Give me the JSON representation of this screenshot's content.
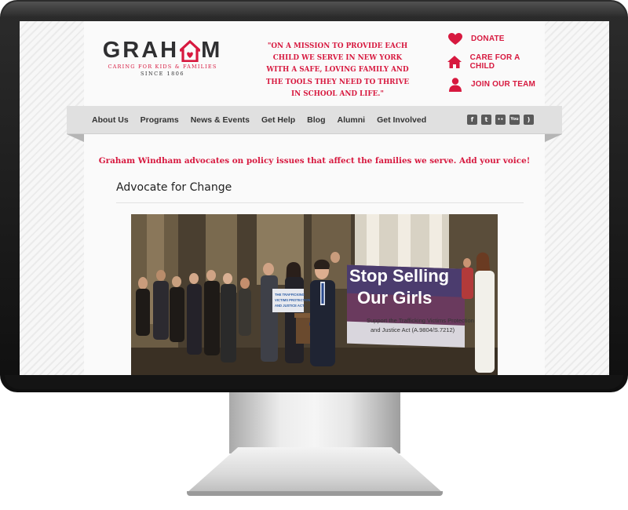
{
  "brand": {
    "logo_word": "GRAHAM",
    "tagline": "CARING FOR KIDS & FAMILIES",
    "since": "SINCE 1806",
    "accent": "#d7193f",
    "dark": "#2f2f31"
  },
  "mission": "\"ON A MISSION TO PROVIDE EACH CHILD WE SERVE IN NEW YORK WITH A SAFE, LOVING FAMILY AND THE TOOLS THEY NEED TO THRIVE IN SCHOOL AND LIFE.\"",
  "quick_links": [
    {
      "label": "DONATE",
      "icon": "heart-icon"
    },
    {
      "label": "CARE FOR A CHILD",
      "icon": "home-icon"
    },
    {
      "label": "JOIN OUR TEAM",
      "icon": "person-icon"
    }
  ],
  "nav": {
    "items": [
      "About Us",
      "Programs",
      "News & Events",
      "Get Help",
      "Blog",
      "Alumni",
      "Get Involved"
    ],
    "social": [
      {
        "icon": "facebook-icon",
        "glyph": "f"
      },
      {
        "icon": "twitter-icon",
        "glyph": "t"
      },
      {
        "icon": "flickr-icon",
        "glyph": "••"
      },
      {
        "icon": "youtube-icon",
        "glyph": "You"
      },
      {
        "icon": "rss-icon",
        "glyph": ")"
      }
    ]
  },
  "content": {
    "advocacy_line": "Graham Windham advocates on policy issues that affect the families we serve. Add your voice!",
    "page_title": "Advocate for Change",
    "hero": {
      "banner_line1": "Stop Selling",
      "banner_line2": "Our Girls",
      "banner_sub1": "Support the Trafficking Victims Protection",
      "banner_sub2": "and Justice Act (A.9804/S.7212)",
      "sign_line1": "THE TRAFFICKING",
      "sign_line2": "VICTIMS PROTECTION",
      "sign_line3": "AND JUSTICE ACT"
    }
  }
}
